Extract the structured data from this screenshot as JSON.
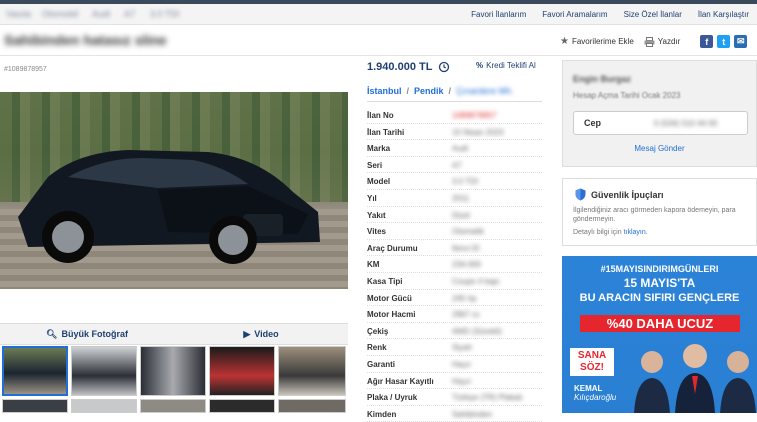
{
  "topnav": {
    "breadcrumbs": [
      "Vasıta",
      "Otomobil",
      "Audi",
      "A7",
      "3.0 TDI"
    ],
    "links": [
      "Favori İlanlarım",
      "Favori Aramalarım",
      "Size Özel İlanlar",
      "İlan Karşılaştır"
    ]
  },
  "listing": {
    "title": "Sahibinden hatasız sline",
    "actions": {
      "favorite": "Favorilerime Ekle",
      "print": "Yazdır"
    },
    "ad_number": "#1089878957",
    "price": "1.940.000 TL",
    "credit_offer": "Kredi Teklifi Al",
    "location": {
      "city": "İstanbul",
      "district": "Pendik",
      "neighborhood": "Çınardere Mh."
    },
    "photo_tabs": {
      "big_photo": "Büyük Fotoğraf",
      "video": "Video"
    }
  },
  "details": [
    {
      "key": "İlan No",
      "value": "1089878957"
    },
    {
      "key": "İlan Tarihi",
      "value": "15 Nisan 2023"
    },
    {
      "key": "Marka",
      "value": "Audi"
    },
    {
      "key": "Seri",
      "value": "A7"
    },
    {
      "key": "Model",
      "value": "3.0 TDI"
    },
    {
      "key": "Yıl",
      "value": "2011"
    },
    {
      "key": "Yakıt",
      "value": "Dizel"
    },
    {
      "key": "Vites",
      "value": "Otomatik"
    },
    {
      "key": "Araç Durumu",
      "value": "İkinci El"
    },
    {
      "key": "KM",
      "value": "234.000"
    },
    {
      "key": "Kasa Tipi",
      "value": "Coupe 4 kapı"
    },
    {
      "key": "Motor Gücü",
      "value": "245 hp"
    },
    {
      "key": "Motor Hacmi",
      "value": "2967 cc"
    },
    {
      "key": "Çekiş",
      "value": "4WD (Sürekli)"
    },
    {
      "key": "Renk",
      "value": "Siyah"
    },
    {
      "key": "Garanti",
      "value": "Hayır"
    },
    {
      "key": "Ağır Hasar Kayıtlı",
      "value": "Hayır"
    },
    {
      "key": "Plaka / Uyruk",
      "value": "Türkiye (TR) Plakalı"
    },
    {
      "key": "Kimden",
      "value": "Sahibinden"
    }
  ],
  "seller": {
    "name": "Engin Burgaz",
    "account_date": "Hesap Açma Tarihi  Ocak 2023",
    "phone_label": "Cep",
    "phone_number": "0 (534) 510 44 00",
    "message": "Mesaj Gönder"
  },
  "safety": {
    "title": "Güvenlik İpuçları",
    "body": "İlgilendiğiniz aracı görmeden kapora ödemeyin, para göndermeyin.",
    "more_prefix": "Detaylı bilgi için",
    "more_link": "tıklayın."
  },
  "ad_banner": {
    "hashtag": "#15MAYISINDIRIMGÜNLERI",
    "line1": "15 MAYIS'TA",
    "line2": "BU ARACIN SIFIRI GENÇLERE",
    "line3": "%40 DAHA UCUZ",
    "sana": "SANA",
    "soz": "SÖZ!",
    "signature_1": "KEMAL",
    "signature_2": "Kılıçdaroğlu"
  },
  "colors": {
    "link": "#1f3f73",
    "accent": "#1f6fd6",
    "ad_blue": "#2b83d8",
    "ad_red": "#e6262e"
  },
  "icons": [
    "history-icon",
    "percent-icon",
    "star-icon",
    "printer-icon",
    "facebook-icon",
    "twitter-icon",
    "share-icon",
    "search-icon",
    "play-icon",
    "shield-icon"
  ]
}
